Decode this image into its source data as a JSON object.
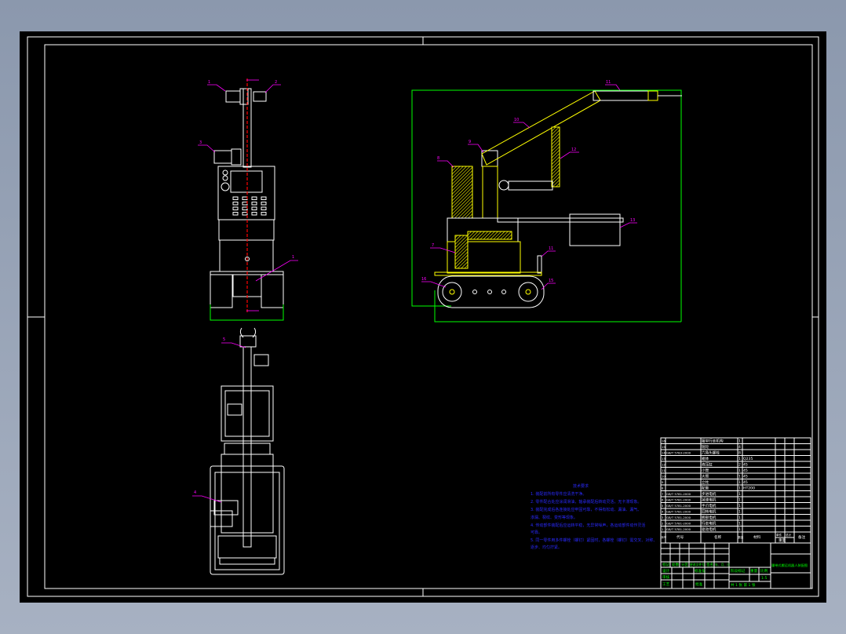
{
  "colors": {
    "sheet": "#000000",
    "lines": "#ffffff",
    "hatch": "#ffff00",
    "dimension": "#00ff00",
    "leader": "#ff00ff",
    "centerline": "#ff0000",
    "notes": "#2a2aff"
  },
  "part_labels": {
    "front": [
      "1",
      "2",
      "3",
      "1"
    ],
    "top": [
      "5",
      "4"
    ],
    "side": [
      "8",
      "9",
      "10",
      "11",
      "12",
      "13",
      "7",
      "16",
      "11",
      "15"
    ]
  },
  "notes": {
    "title": "技术要求",
    "lines": [
      "1. 装配前所有零件应清洗干净。",
      "2. 零件配合处应涂润滑油，轴承装配后转动灵活，无卡滞现象。",
      "3. 装配完成后各连接处应牢固可靠，不得有松动、漏油、漏气、",
      "渗漏、裂纹、变形等现象。",
      "4. 传动部件装配后应运转平稳，无异常噪声，各运动部件动作灵活",
      "可靠。",
      "5. 同一零件用多件螺栓（螺钉）紧固时，各螺栓（螺钉）需交叉、对称、",
      "逐步、均匀拧紧。"
    ]
  },
  "bom": {
    "rows": [
      {
        "no": "16",
        "code": "",
        "name": "履带行走机构",
        "qty": "1",
        "material": ""
      },
      {
        "no": "15",
        "code": "",
        "name": "链轮",
        "qty": "4",
        "material": ""
      },
      {
        "no": "14",
        "code": "GB/T 5783-2000",
        "name": "六角头螺栓",
        "qty": "8",
        "material": ""
      },
      {
        "no": "13",
        "code": "",
        "name": "箱体",
        "qty": "1",
        "material": "Q235"
      },
      {
        "no": "12",
        "code": "",
        "name": "液压缸",
        "qty": "2",
        "material": "45"
      },
      {
        "no": "11",
        "code": "",
        "name": "小臂",
        "qty": "1",
        "material": "45"
      },
      {
        "no": "10",
        "code": "",
        "name": "大臂",
        "qty": "1",
        "material": "45"
      },
      {
        "no": "9",
        "code": "",
        "name": "立柱",
        "qty": "1",
        "material": "45"
      },
      {
        "no": "8",
        "code": "",
        "name": "配重",
        "qty": "1",
        "material": "HT200"
      },
      {
        "no": "7",
        "code": "GB/T 5781-2000",
        "name": "步进电机",
        "qty": "1",
        "material": ""
      },
      {
        "no": "6",
        "code": "GB/T 5781-2000",
        "name": "减速电机",
        "qty": "1",
        "material": ""
      },
      {
        "no": "5",
        "code": "GB/T 5781-2000",
        "name": "手爪电机",
        "qty": "1",
        "material": ""
      },
      {
        "no": "4",
        "code": "GB/T 5781-2000",
        "name": "回转电机",
        "qty": "1",
        "material": ""
      },
      {
        "no": "3",
        "code": "GB/T 5781-2000",
        "name": "腕部电机",
        "qty": "1",
        "material": ""
      },
      {
        "no": "2",
        "code": "GB/T 5781-2000",
        "name": "行走电机",
        "qty": "1",
        "material": ""
      },
      {
        "no": "1",
        "code": "GB/T 5781-2000",
        "name": "驱动电机",
        "qty": "1",
        "material": ""
      }
    ],
    "header": {
      "no": "序号",
      "code": "代号",
      "name": "名称",
      "qty": "数量",
      "material": "材料",
      "single": "单件",
      "total": "总计",
      "weight": "重量",
      "remark": "备注"
    }
  },
  "title_block": {
    "revision_row": [
      "标记",
      "处数",
      "分区",
      "更改文件号",
      "签名",
      "年、月、日"
    ],
    "design": "设计",
    "standard": "标准化",
    "review": "审核",
    "process": "工艺",
    "approve": "批准",
    "stage": "阶段标记",
    "weight": "重量",
    "scale": "比例",
    "scale_value": "1:5",
    "sheets": "共 1 张  第 1 张",
    "drawing_title": "履带式搬运机器人装配图"
  }
}
